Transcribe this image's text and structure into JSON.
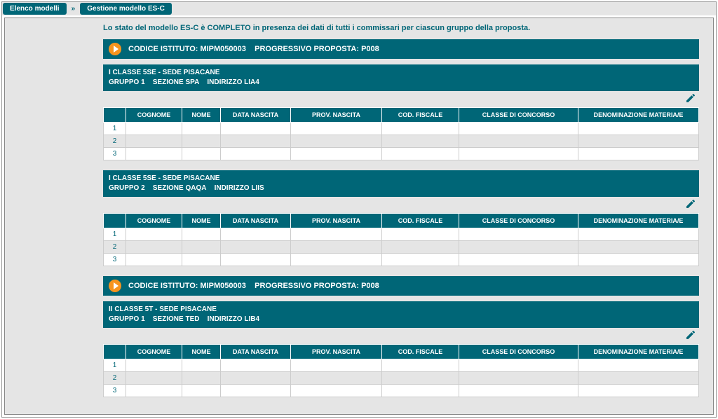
{
  "breadcrumb": {
    "item1": "Elenco modelli",
    "item2": "Gestione modello ES-C"
  },
  "status_message": "Lo stato del modello ES-C è COMPLETO in presenza dei dati di tutti i commissari per ciascun gruppo della proposta.",
  "table_headers": {
    "blank": "",
    "cognome": "COGNOME",
    "nome": "NOME",
    "data_nascita": "DATA NASCITA",
    "prov_nascita": "PROV. NASCITA",
    "cod_fiscale": "COD. FISCALE",
    "classe_concorso": "CLASSE DI CONCORSO",
    "denominazione": "DENOMINAZIONE MATERIA/E"
  },
  "proposals": [
    {
      "header": "CODICE ISTITUTO: MIPM050003    PROGRESSIVO PROPOSTA: P008",
      "groups": [
        {
          "line1": "I CLASSE 5SE - SEDE PISACANE",
          "line2": "GRUPPO 1    SEZIONE SPA    INDIRIZZO LIA4",
          "rows": [
            "1",
            "2",
            "3"
          ]
        },
        {
          "line1": "I CLASSE 5SE - SEDE PISACANE",
          "line2": "GRUPPO 2    SEZIONE QAQA    INDIRIZZO LIIS",
          "rows": [
            "1",
            "2",
            "3"
          ]
        }
      ]
    },
    {
      "header": "CODICE ISTITUTO: MIPM050003    PROGRESSIVO PROPOSTA: P008",
      "groups": [
        {
          "line1": "II CLASSE 5T - SEDE PISACANE",
          "line2": "GRUPPO 1    SEZIONE TED    INDIRIZZO LIB4",
          "rows": [
            "1",
            "2",
            "3"
          ]
        }
      ]
    }
  ]
}
